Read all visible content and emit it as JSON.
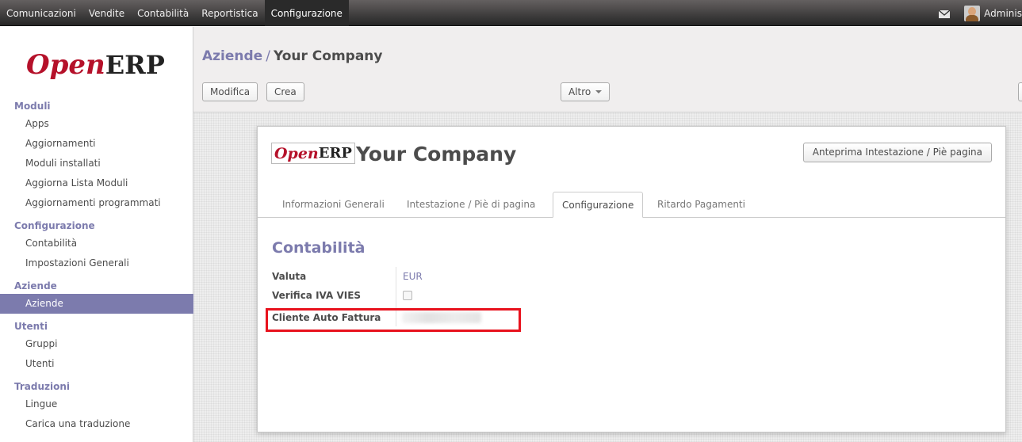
{
  "topbar": {
    "menu": [
      {
        "label": "Comunicazioni"
      },
      {
        "label": "Vendite"
      },
      {
        "label": "Contabilità"
      },
      {
        "label": "Reportistica"
      },
      {
        "label": "Configurazione",
        "active": true
      }
    ],
    "user": "Adminis"
  },
  "logo": {
    "open": "Open",
    "erp": "ERP"
  },
  "sidebar": {
    "sections": [
      {
        "title": "Moduli",
        "items": [
          "Apps",
          "Aggiornamenti",
          "Moduli installati",
          "Aggiorna Lista Moduli",
          "Aggiornamenti programmati"
        ]
      },
      {
        "title": "Configurazione",
        "items": [
          "Contabilità",
          "Impostazioni Generali"
        ]
      },
      {
        "title": "Aziende",
        "items": [
          "Aziende"
        ]
      },
      {
        "title": "Utenti",
        "items": [
          "Gruppi",
          "Utenti"
        ]
      },
      {
        "title": "Traduzioni",
        "items": [
          "Lingue",
          "Carica una traduzione"
        ]
      }
    ],
    "active_item": "Aziende"
  },
  "header": {
    "breadcrumb_parent": "Aziende",
    "breadcrumb_sep": "/",
    "breadcrumb_current": "Your Company",
    "edit_label": "Modifica",
    "create_label": "Crea",
    "more_label": "Altro"
  },
  "form": {
    "company_name": "Your Company",
    "preview_button": "Anteprima Intestazione / Piè pagina",
    "tabs": [
      "Informazioni Generali",
      "Intestazione / Piè di pagina",
      "Configurazione",
      "Ritardo Pagamenti"
    ],
    "active_tab": "Configurazione",
    "section_title": "Contabilità",
    "fields": {
      "currency_label": "Valuta",
      "currency_value": "EUR",
      "vies_label": "Verifica IVA VIES",
      "vies_checked": false,
      "self_invoice_label": "Cliente Auto Fattura"
    }
  },
  "colors": {
    "accent": "#7c7bad",
    "brand_red": "#b5112a",
    "highlight": "#e8121d"
  }
}
